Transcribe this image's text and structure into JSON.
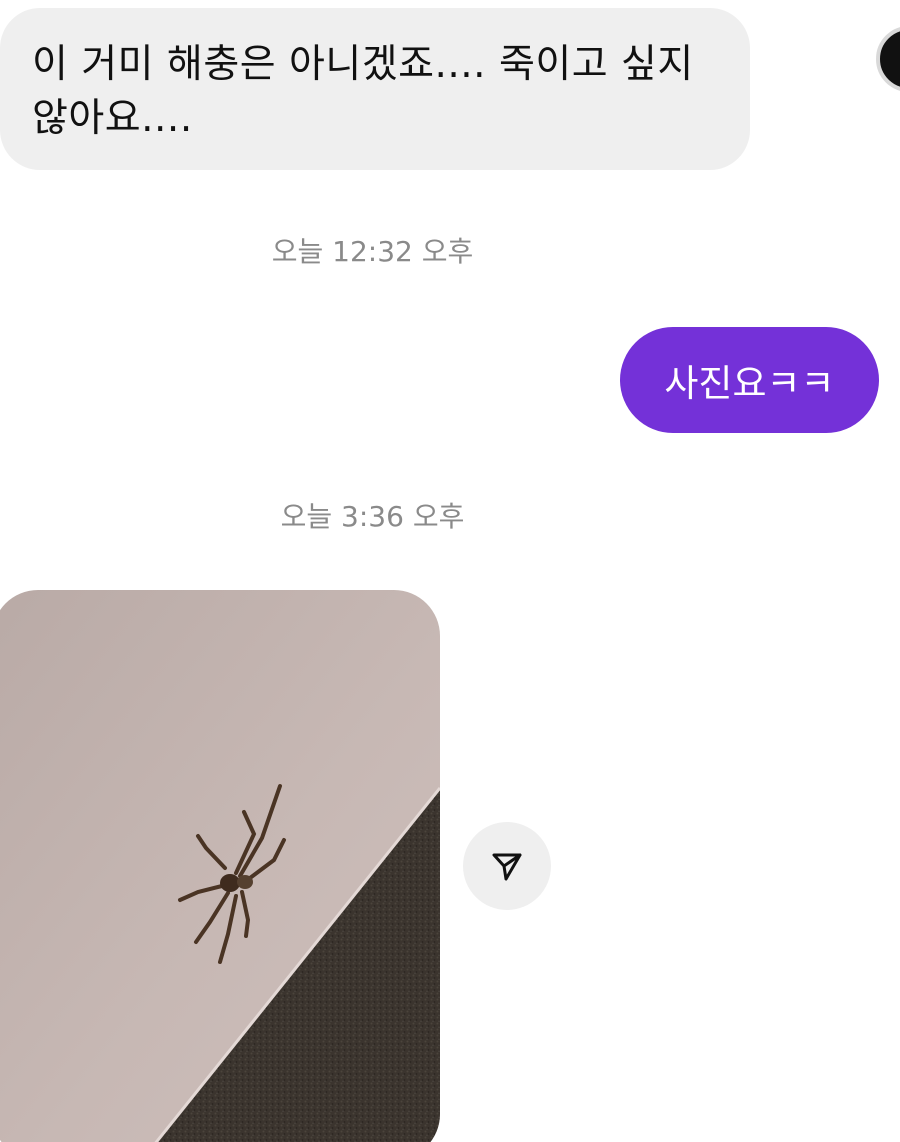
{
  "messages": {
    "incoming_text": "이 거미 해충은 아니겠죠.... 죽이고 싶지 않아요....",
    "timestamp_1": "오늘 12:32 오후",
    "outgoing_text": "사진요ㅋㅋ",
    "timestamp_2": "오늘 3:36 오후"
  },
  "photo": {
    "subject": "spider-on-wall-photo"
  },
  "icons": {
    "share": "paper-plane-icon"
  },
  "colors": {
    "outgoing_bubble": "#7431d8",
    "incoming_bubble": "#efefef",
    "timestamp": "#8a8a8a"
  }
}
